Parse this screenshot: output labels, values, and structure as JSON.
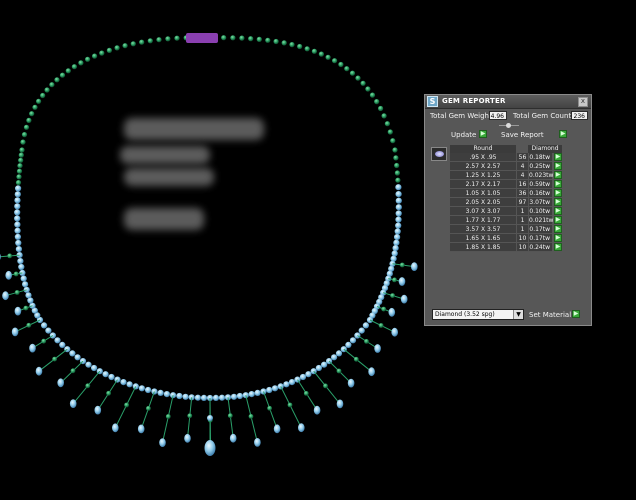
{
  "panel": {
    "title": "GEM REPORTER",
    "close_glyph": "x",
    "total_gem_weight_label": "Total Gem Weight",
    "total_gem_weight_value": "4.96",
    "total_gem_count_label": "Total Gem Count",
    "total_gem_count_value": "236",
    "update_label": "Update",
    "save_report_label": "Save Report",
    "col_shape": "Round",
    "col_material": "Diamond",
    "rows": [
      {
        "size": ".95 X .95",
        "count": "56",
        "weight": "0.18tw"
      },
      {
        "size": "2.57 X 2.57",
        "count": "4",
        "weight": "0.25tw"
      },
      {
        "size": "1.25 X 1.25",
        "count": "4",
        "weight": "0.023tw"
      },
      {
        "size": "2.17 X 2.17",
        "count": "16",
        "weight": "0.59tw"
      },
      {
        "size": "1.05 X 1.05",
        "count": "36",
        "weight": "0.16tw"
      },
      {
        "size": "2.05 X 2.05",
        "count": "97",
        "weight": "3.07tw"
      },
      {
        "size": "3.07 X 3.07",
        "count": "1",
        "weight": "0.10tw"
      },
      {
        "size": "1.77 X 1.77",
        "count": "1",
        "weight": "0.021tw"
      },
      {
        "size": "3.57 X 3.57",
        "count": "1",
        "weight": "0.17tw"
      },
      {
        "size": "1.65 X 1.65",
        "count": "10",
        "weight": "0.17tw"
      },
      {
        "size": "1.85 X 1.85",
        "count": "10",
        "weight": "0.24tw"
      }
    ],
    "material_select_value": "Diamond    (3.52 spg)",
    "set_material_label": "Set Material"
  },
  "icons": {
    "app": "gem-reporter-icon",
    "green_button": "play-arrow-icon",
    "gem_thumbnail": "round-gem-icon"
  },
  "colors": {
    "background": "#000000",
    "panel": "#575757",
    "button_green": "#38a838",
    "emerald": "#1f8a52",
    "diamond": "#8ec9e8",
    "clasp": "#8a3fb0"
  }
}
